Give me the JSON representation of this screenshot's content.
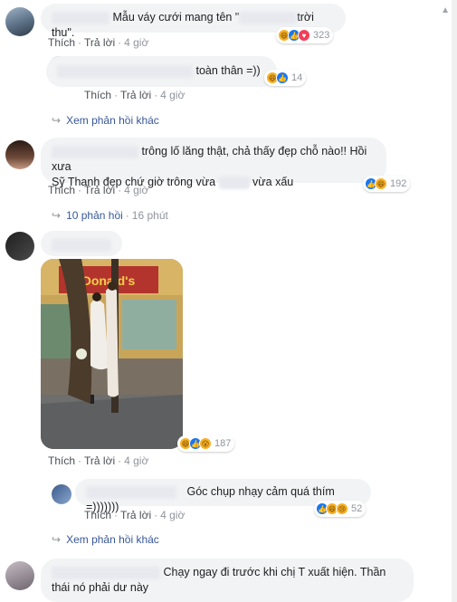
{
  "comments": [
    {
      "text": "Mẫu váy cưới mang tên \"",
      "text_end": "trời thu\".",
      "reactions": {
        "icons": [
          "haha-icon",
          "like-icon",
          "love-icon"
        ],
        "count": "323"
      },
      "actions": {
        "like": "Thích",
        "reply": "Trả lời",
        "time": "4 giờ"
      }
    },
    {
      "text": "toàn thân =))",
      "reactions": {
        "icons": [
          "haha-icon",
          "like-icon"
        ],
        "count": "14"
      },
      "actions": {
        "like": "Thích",
        "reply": "Trả lời",
        "time": "4 giờ"
      }
    },
    {
      "text_line1": "trông lố lăng thật, chả thấy đẹp chỗ nào!! Hồi xưa",
      "text_line2": "Sỹ Thanh đẹp chứ giờ trông vừa",
      "text_line2_end": "vừa xấu",
      "reactions": {
        "icons": [
          "like-icon",
          "haha-icon"
        ],
        "count": "192"
      },
      "actions": {
        "like": "Thích",
        "reply": "Trả lời",
        "time": "4 giờ"
      }
    },
    {
      "reactions": {
        "icons": [
          "haha-icon",
          "like-icon",
          "wow-icon"
        ],
        "count": "187"
      },
      "actions": {
        "like": "Thích",
        "reply": "Trả lời",
        "time": "4 giờ"
      },
      "photo_sign": "Donald's"
    },
    {
      "text": "Góc chụp nhạy cảm quá thím =)))))))",
      "reactions": {
        "icons": [
          "like-icon",
          "haha-icon",
          "sad-icon"
        ],
        "count": "52"
      },
      "actions": {
        "like": "Thích",
        "reply": "Trả lời",
        "time": "4 giờ"
      }
    },
    {
      "text_line1": "Chạy ngay đi trước khi chị T xuất hiện. Thần",
      "text_line2": "thái nó phải dư này"
    }
  ],
  "more_replies_1": "Xem phản hồi khác",
  "replies_count": {
    "label": "10 phản hồi",
    "time": "16 phút"
  },
  "more_replies_2": "Xem phản hồi khác"
}
